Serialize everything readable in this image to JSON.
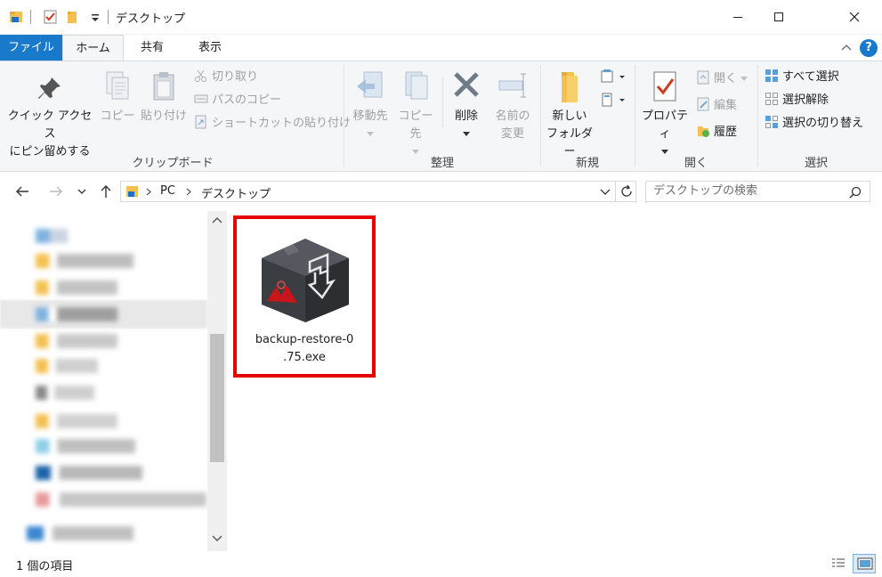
{
  "window": {
    "title": "デスクトップ",
    "help_label": "?"
  },
  "tabs": [
    {
      "label": "ファイル"
    },
    {
      "label": "ホーム"
    },
    {
      "label": "共有"
    },
    {
      "label": "表示"
    }
  ],
  "ribbon": {
    "clipboard": {
      "group_label": "クリップボード",
      "pin_label_1": "クイック アクセス",
      "pin_label_2": "にピン留めする",
      "copy_label": "コピー",
      "paste_label": "貼り付け",
      "cut_label": "切り取り",
      "copy_path_label": "パスのコピー",
      "paste_shortcut_label": "ショートカットの貼り付け"
    },
    "organize": {
      "group_label": "整理",
      "move_label": "移動先",
      "copyto_label": "コピー先",
      "delete_label": "削除",
      "rename_label_1": "名前の",
      "rename_label_2": "変更"
    },
    "new": {
      "group_label": "新規",
      "new_folder_label_1": "新しい",
      "new_folder_label_2": "フォルダー"
    },
    "open": {
      "group_label": "開く",
      "properties_label": "プロパティ",
      "open_label": "開く",
      "edit_label": "編集",
      "history_label": "履歴"
    },
    "select": {
      "group_label": "選択",
      "select_all_label": "すべて選択",
      "select_none_label": "選択解除",
      "invert_label": "選択の切り替え"
    }
  },
  "address": {
    "segments": [
      "PC",
      "デスクトップ"
    ],
    "search_placeholder": "デスクトップの検索"
  },
  "files": [
    {
      "name_line1": "backup-restore-0",
      "name_line2": ".75.exe"
    }
  ],
  "status": {
    "item_count": "1 個の項目"
  },
  "colors": {
    "file_tab": "#1979ca",
    "highlight_border": "#e60000",
    "help_circle": "#1979ca"
  }
}
